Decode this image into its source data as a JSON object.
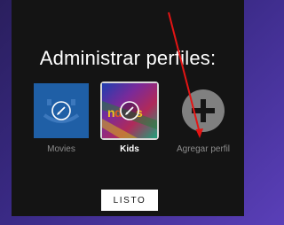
{
  "page_title": "Administrar perfiles:",
  "profiles": [
    {
      "label": "Movies",
      "tile_color": "#1f5fa6"
    },
    {
      "label": "Kids",
      "tile_color": "#6d2b8c"
    }
  ],
  "add_profile": {
    "label": "Agregar perfil"
  },
  "done_button": {
    "label": "LISTO"
  },
  "colors": {
    "background": "#141414",
    "annotation_arrow": "#e41414"
  }
}
